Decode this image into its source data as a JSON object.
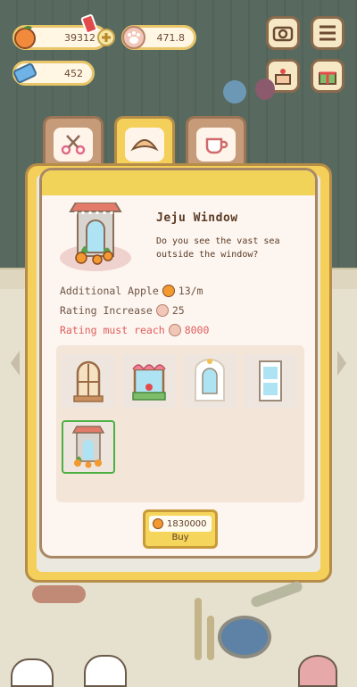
{
  "hud": {
    "apples": "39312",
    "paws": "471.8",
    "tickets": "452"
  },
  "tabs": [
    {
      "name": "scissors-tab"
    },
    {
      "name": "furniture-tab"
    },
    {
      "name": "cup-tab"
    }
  ],
  "item": {
    "title": "Jeju Window",
    "description": "Do you see the vast sea outside the window?",
    "stats": [
      {
        "label": "Additional Apple",
        "value": "13/m"
      },
      {
        "label": "Rating Increase",
        "value": "25"
      },
      {
        "label": "Rating must reach",
        "value": "8000"
      }
    ]
  },
  "buy": {
    "price": "1830000",
    "label": "Buy"
  },
  "colors": {
    "selected_border": "#4cb142",
    "panel_yellow": "#f2d35a",
    "warning_red": "#e05d5d"
  }
}
